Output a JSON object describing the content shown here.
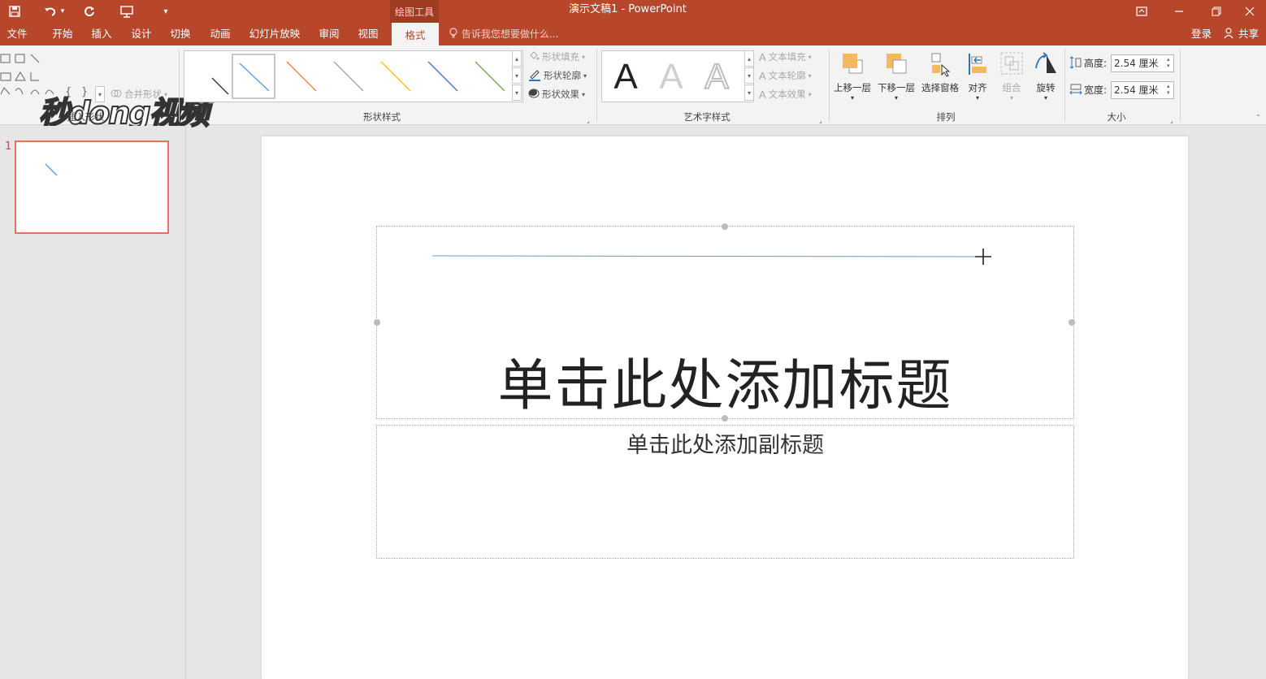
{
  "app": {
    "window_title": "演示文稿1 - PowerPoint",
    "context_group": "绘图工具"
  },
  "qat": {
    "save_icon": "save-icon",
    "undo_icon": "undo-icon",
    "redo_icon": "repeat-icon",
    "present_icon": "start-from-beginning-icon",
    "customize_icon": "customize-qat-icon"
  },
  "tabs": [
    {
      "label": "文件"
    },
    {
      "label": "开始"
    },
    {
      "label": "插入"
    },
    {
      "label": "设计"
    },
    {
      "label": "切换"
    },
    {
      "label": "动画"
    },
    {
      "label": "幻灯片放映"
    },
    {
      "label": "审阅"
    },
    {
      "label": "视图"
    },
    {
      "label": "格式"
    }
  ],
  "tell_me": "告诉我您想要做什么...",
  "account": {
    "signin": "登录",
    "share": "共享"
  },
  "ribbon": {
    "insert_shapes": {
      "label": "插入形状",
      "merge_shapes": "合并形状"
    },
    "shape_styles": {
      "label": "形状样式",
      "fill": "形状填充",
      "outline": "形状轮廓",
      "effects": "形状效果",
      "line_colors": [
        "#333333",
        "#5b9bd5",
        "#ed7d31",
        "#a5a5a5",
        "#ffc000",
        "#4472c4",
        "#70ad47"
      ]
    },
    "wordart_styles": {
      "label": "艺术字样式",
      "text_fill": "文本填充",
      "text_outline": "文本轮廓",
      "text_effects": "文本效果",
      "letter": "A"
    },
    "arrange": {
      "label": "排列",
      "bring_forward": "上移一层",
      "send_backward": "下移一层",
      "selection_pane": "选择窗格",
      "align": "对齐",
      "group": "组合",
      "rotate": "旋转"
    },
    "size": {
      "label": "大小",
      "height_label": "高度:",
      "height_value": "2.54 厘米",
      "width_label": "宽度:",
      "width_value": "2.54 厘米"
    }
  },
  "watermark": "秒dong视频",
  "thumbnails": [
    {
      "number": "1"
    }
  ],
  "slide": {
    "title_placeholder": "单击此处添加标题",
    "subtitle_placeholder": "单击此处添加副标题",
    "line_color": "#5b9bd5"
  },
  "colors": {
    "accent": "#b7472a",
    "selection": "#e5735a"
  }
}
